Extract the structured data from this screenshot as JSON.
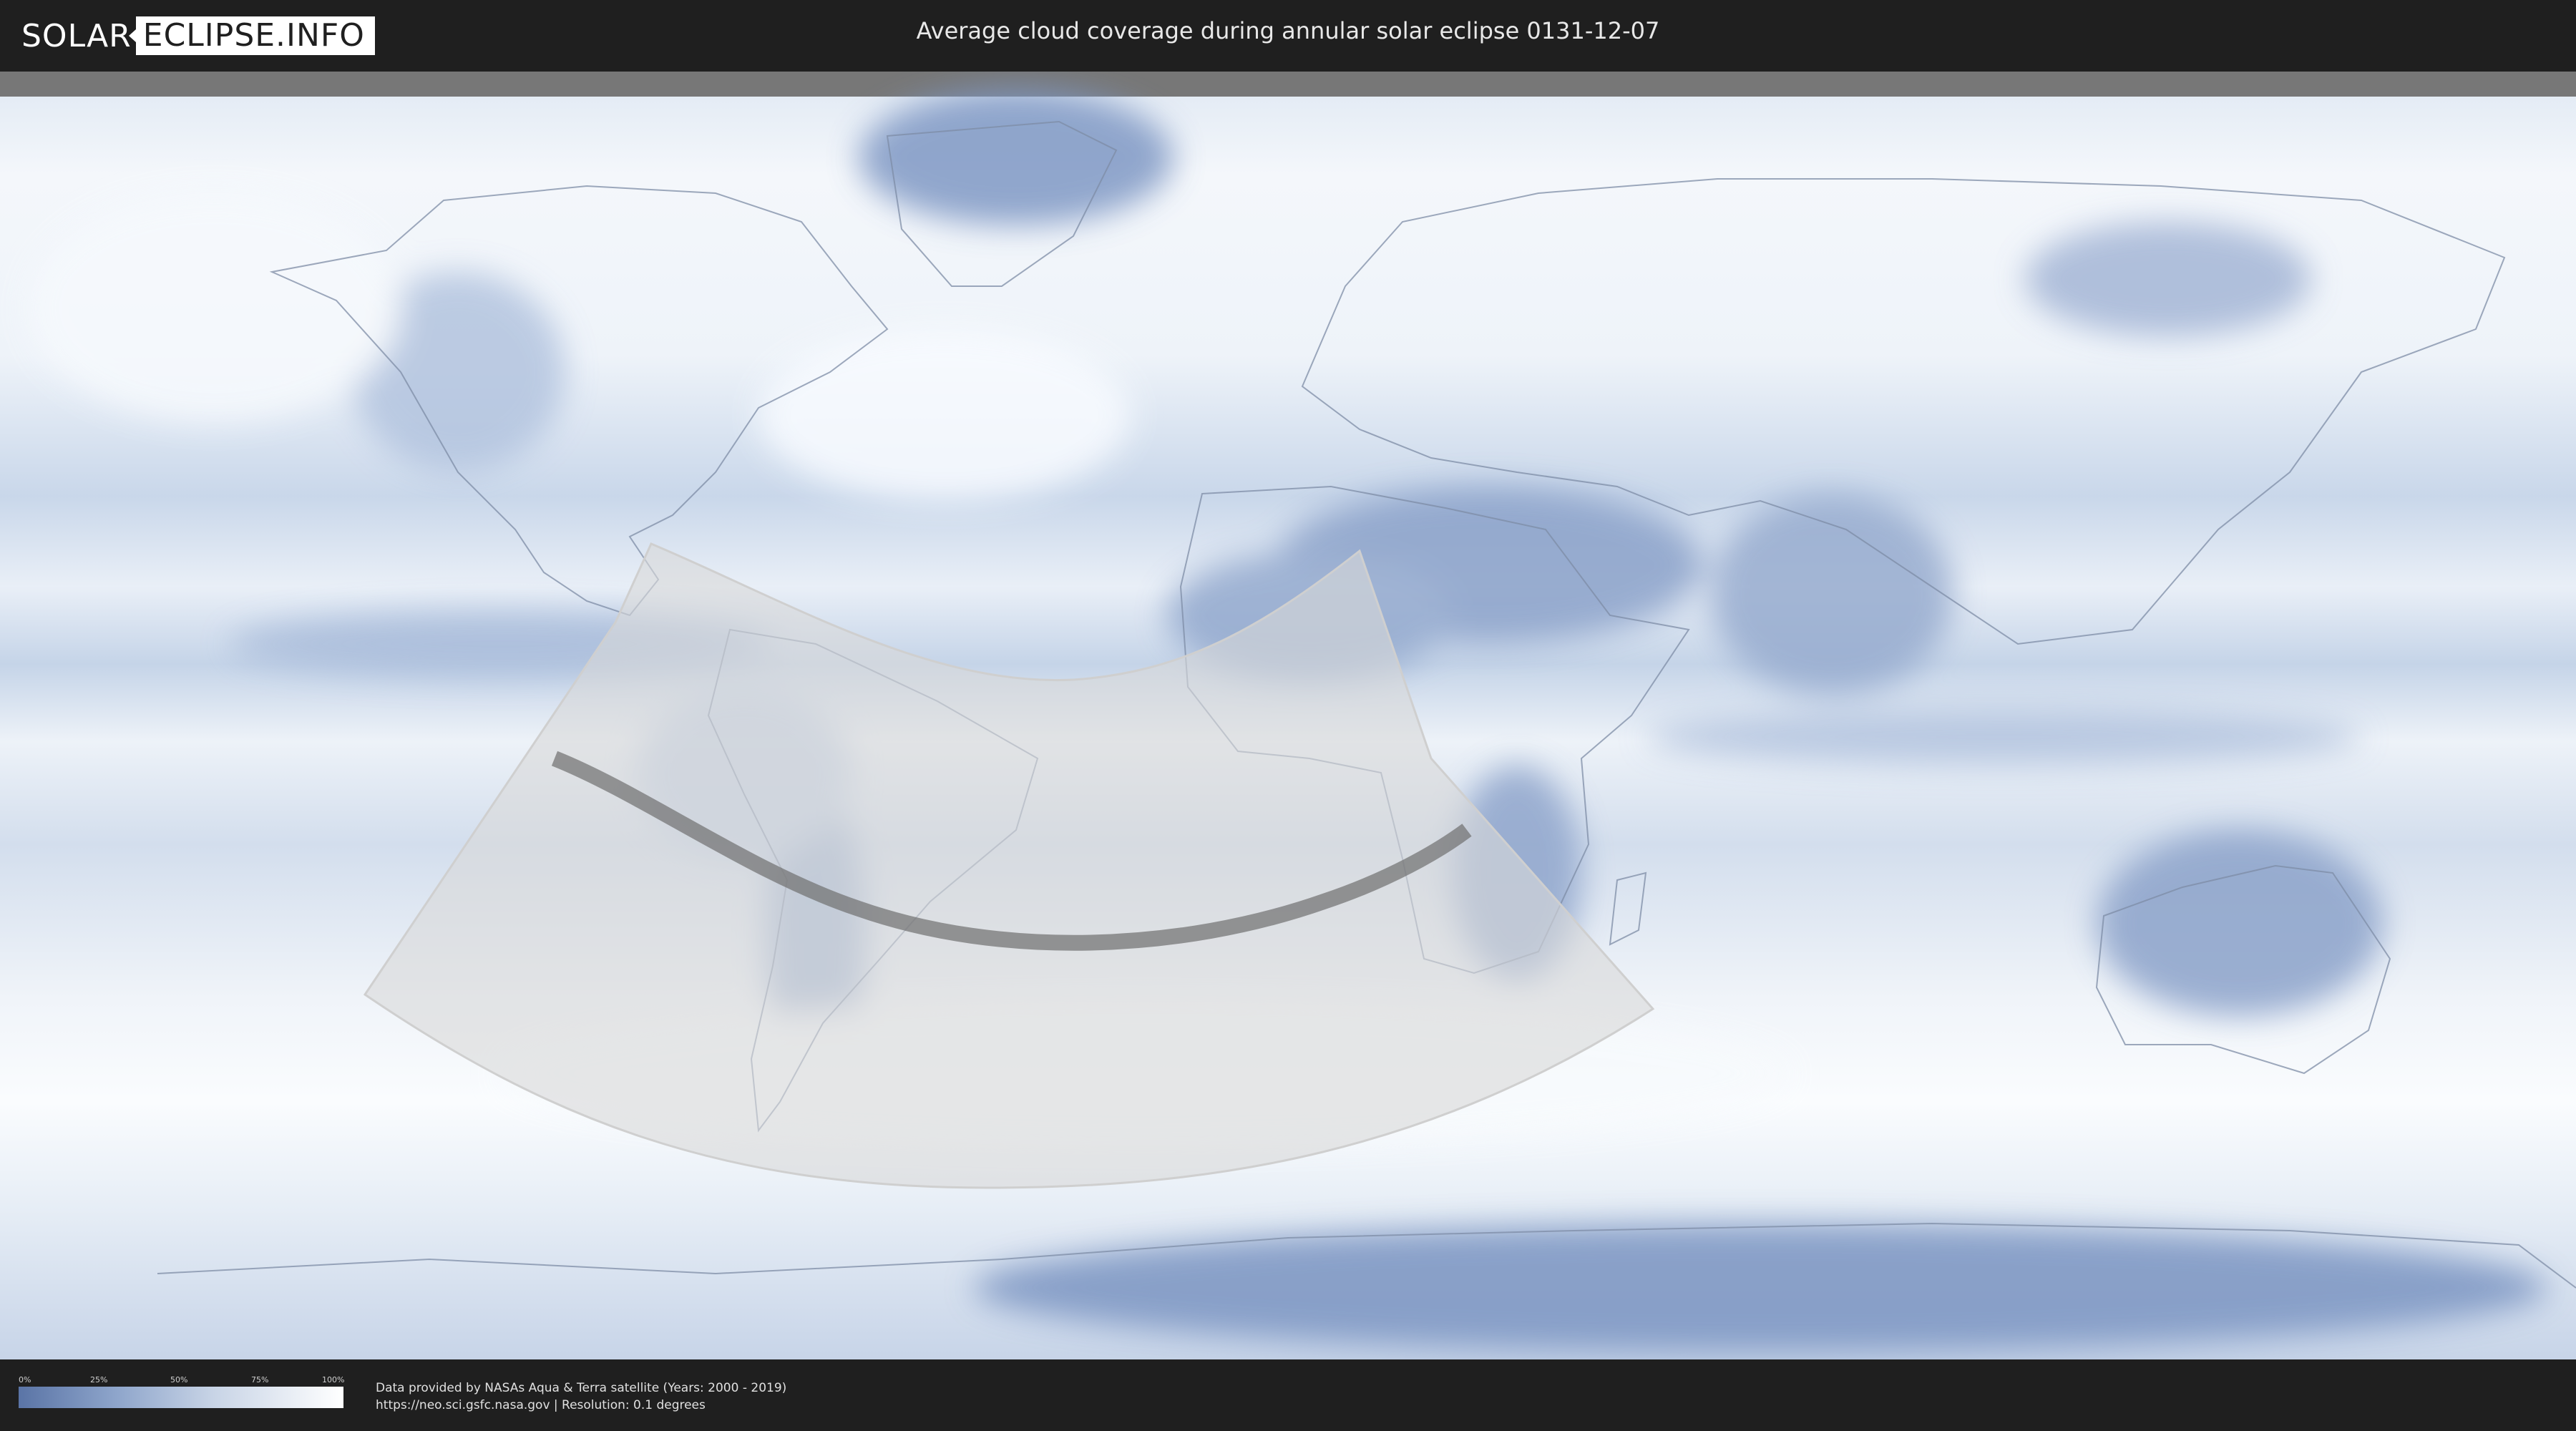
{
  "header": {
    "logo_left": "SOLAR",
    "logo_right": "ECLIPSE.INFO",
    "title": "Average cloud coverage during annular solar eclipse 0131-12-07"
  },
  "colors": {
    "background": "#1f1f1f",
    "cloud_dense": "#ffffff",
    "cloud_clear": "#5a74a6",
    "visibility_zone": "#d9d9d9",
    "eclipse_path": "#6f6f6f"
  },
  "map": {
    "projection": "equirectangular",
    "layers": [
      "cloud-coverage",
      "country-borders",
      "eclipse-visibility-zone",
      "eclipse-central-path"
    ]
  },
  "legend": {
    "ticks": [
      "0%",
      "25%",
      "50%",
      "75%",
      "100%"
    ]
  },
  "footer": {
    "source_line1": "Data provided by NASAs Aqua & Terra satellite (Years: 2000 - 2019)",
    "source_line2": "https://neo.sci.gsfc.nasa.gov | Resolution: 0.1 degrees"
  }
}
